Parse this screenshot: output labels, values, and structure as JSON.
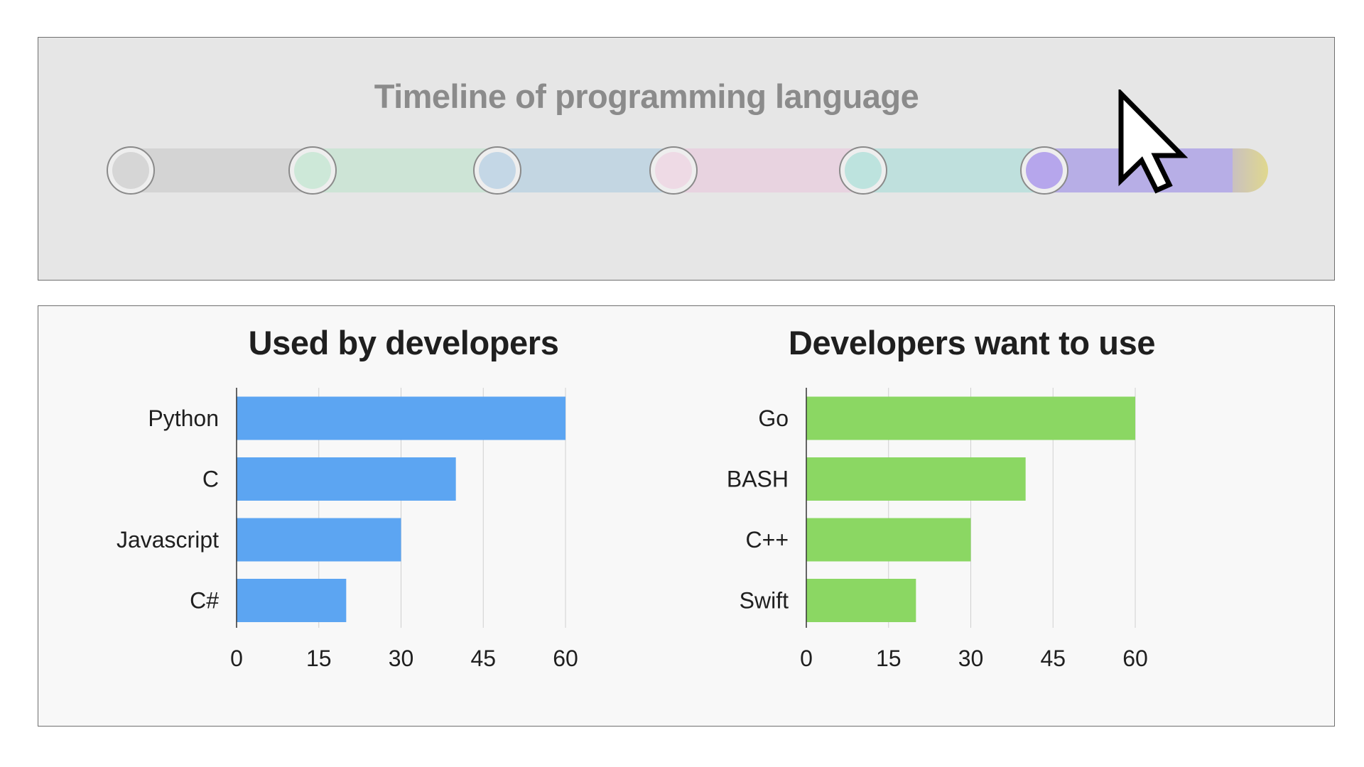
{
  "timeline": {
    "title": "Timeline of programming language",
    "segment_colors": [
      "#d4d4d4",
      "#cde4d6",
      "#c3d6e2",
      "#e8d3e0",
      "#bfe0dd",
      "#b7aee6"
    ],
    "end_color": "#e0d88e",
    "node_fill_colors": [
      "#d6d6d6",
      "#cde8d8",
      "#c4d7e6",
      "#eedae5",
      "#bde3de",
      "#b6a6ec"
    ]
  },
  "chart_data": [
    {
      "type": "bar",
      "orientation": "horizontal",
      "title": "Used by developers",
      "categories": [
        "Python",
        "C",
        "Javascript",
        "C#"
      ],
      "values": [
        60,
        40,
        30,
        20
      ],
      "xlim": [
        0,
        60
      ],
      "xticks": [
        "0",
        "15",
        "30",
        "45",
        "60"
      ],
      "xlabel": "",
      "ylabel": "",
      "grid": true,
      "bar_color": "#5ca5f2"
    },
    {
      "type": "bar",
      "orientation": "horizontal",
      "title": "Developers want to use",
      "categories": [
        "Go",
        "BASH",
        "C++",
        "Swift"
      ],
      "values": [
        60,
        40,
        30,
        20
      ],
      "xlim": [
        0,
        60
      ],
      "xticks": [
        "0",
        "15",
        "30",
        "45",
        "60"
      ],
      "xlabel": "",
      "ylabel": "",
      "grid": true,
      "bar_color": "#8bd763"
    }
  ]
}
